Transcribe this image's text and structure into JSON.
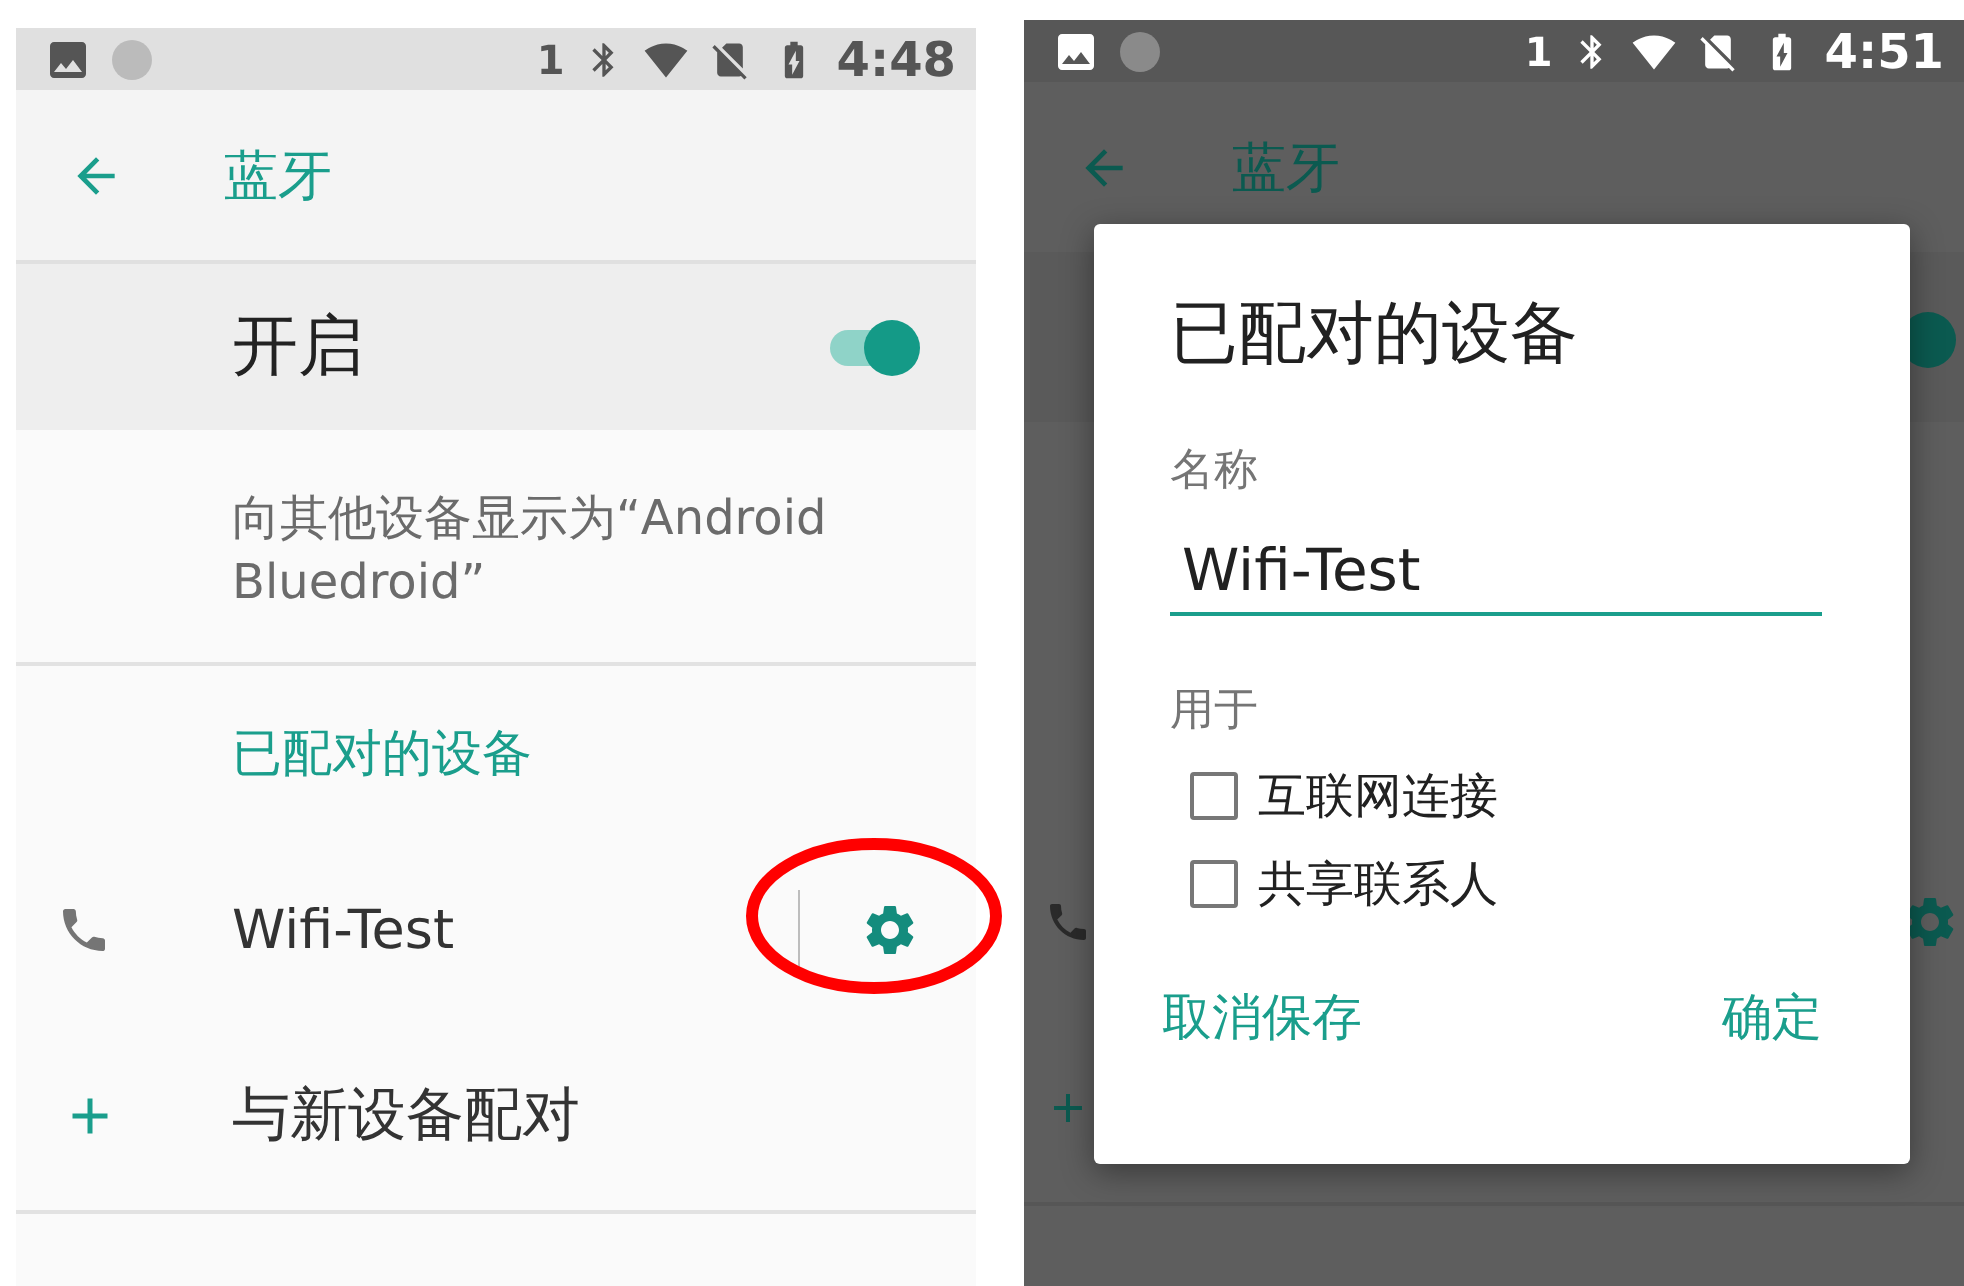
{
  "left_screen": {
    "status_bar": {
      "sim": "1",
      "time": "4:48"
    },
    "app_bar": {
      "title": "蓝牙"
    },
    "master_switch": {
      "label": "开启",
      "on": true
    },
    "visibility_note": "向其他设备显示为“Android Bluedroid”",
    "section_header": "已配对的设备",
    "paired_devices": [
      {
        "name": "Wifi-Test"
      }
    ],
    "pair_new": {
      "label": "与新设备配对"
    }
  },
  "right_screen": {
    "status_bar": {
      "sim": "1",
      "time": "4:51"
    },
    "app_bar": {
      "title": "蓝牙"
    },
    "master_switch": {
      "on": true
    },
    "dialog": {
      "title": "已配对的设备",
      "name_label": "名称",
      "name_value": "Wifi-Test",
      "usage_label": "用于",
      "options": [
        {
          "label": "互联网连接",
          "checked": false
        },
        {
          "label": "共享联系人",
          "checked": false
        }
      ],
      "buttons": [
        {
          "label": "取消保存"
        },
        {
          "label": "确定"
        }
      ]
    }
  }
}
